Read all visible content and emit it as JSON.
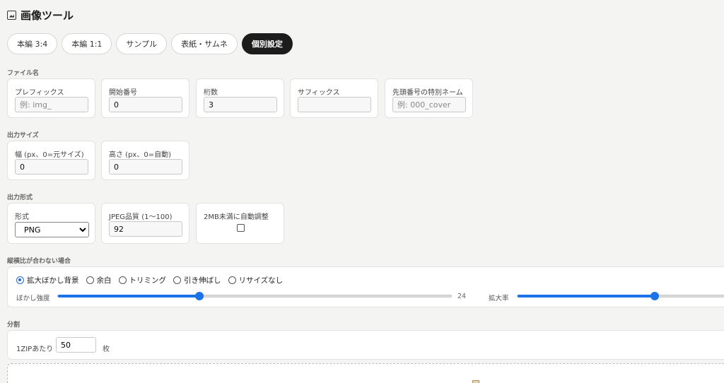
{
  "app": {
    "title": "画像ツール",
    "icon": "image-icon"
  },
  "tabs": [
    {
      "label": "本編 3:4",
      "active": false
    },
    {
      "label": "本編 1:1",
      "active": false
    },
    {
      "label": "サンプル",
      "active": false
    },
    {
      "label": "表紙・サムネ",
      "active": false
    },
    {
      "label": "個別設定",
      "active": true
    }
  ],
  "filename": {
    "section": "ファイル名",
    "prefix": {
      "label": "プレフィックス",
      "value": "",
      "placeholder": "例: img_"
    },
    "start": {
      "label": "開始番号",
      "value": "0",
      "placeholder": ""
    },
    "digits": {
      "label": "桁数",
      "value": "3",
      "placeholder": ""
    },
    "suffix": {
      "label": "サフィックス",
      "value": "",
      "placeholder": ""
    },
    "first_name": {
      "label": "先頭番号の特別ネーム",
      "value": "",
      "placeholder": "例: 000_cover"
    }
  },
  "output_size": {
    "section": "出力サイズ",
    "width": {
      "label": "幅 (px、0=元サイズ)",
      "value": "0"
    },
    "height": {
      "label": "高さ (px、0=自動)",
      "value": "0"
    }
  },
  "output_format": {
    "section": "出力形式",
    "format": {
      "label": "形式",
      "value": "PNG",
      "options": [
        "PNG"
      ]
    },
    "quality": {
      "label": "JPEG品質 (1〜100)",
      "value": "92"
    },
    "auto_2mb": {
      "label": "2MB未満に自動調整",
      "checked": false
    }
  },
  "aspect": {
    "section": "縦横比が合わない場合",
    "options": [
      {
        "label": "拡大ぼかし背景",
        "checked": true
      },
      {
        "label": "余白",
        "checked": false
      },
      {
        "label": "トリミング",
        "checked": false
      },
      {
        "label": "引き伸ばし",
        "checked": false
      },
      {
        "label": "リサイズなし",
        "checked": false
      }
    ],
    "blur": {
      "label": "ぼかし強度",
      "value": "24",
      "fraction": 0.36
    },
    "zoom": {
      "label": "拡大率",
      "fraction": 0.63
    }
  },
  "split": {
    "section": "分割",
    "label": "1ZIPあたり",
    "value": "50",
    "unit": "枚"
  },
  "colors": {
    "accent": "#1a73e8",
    "active_tab": "#1c1c1c"
  }
}
